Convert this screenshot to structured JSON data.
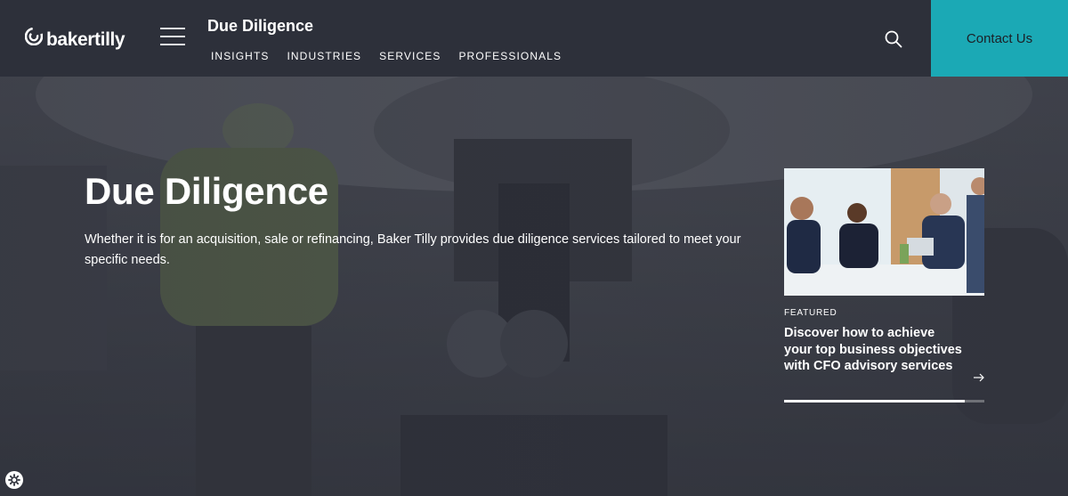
{
  "brand": {
    "name": "bakertilly"
  },
  "header": {
    "section_title": "Due Diligence",
    "nav": [
      "INSIGHTS",
      "INDUSTRIES",
      "SERVICES",
      "PROFESSIONALS"
    ],
    "contact_label": "Contact Us"
  },
  "hero": {
    "title": "Due Diligence",
    "description": "Whether it is for an acquisition, sale or refinancing, Baker Tilly provides due diligence services tailored to meet your specific needs."
  },
  "featured": {
    "label": "FEATURED",
    "title": "Discover how to achieve your top business objectives with CFO advisory services",
    "progress": 0.9
  },
  "colors": {
    "header_bg": "#2d303a",
    "accent": "#1ba9b5"
  },
  "icons": [
    "bakertilly-logo-icon",
    "hamburger-menu-icon",
    "search-icon",
    "arrow-right-icon",
    "cookie-settings-icon"
  ]
}
